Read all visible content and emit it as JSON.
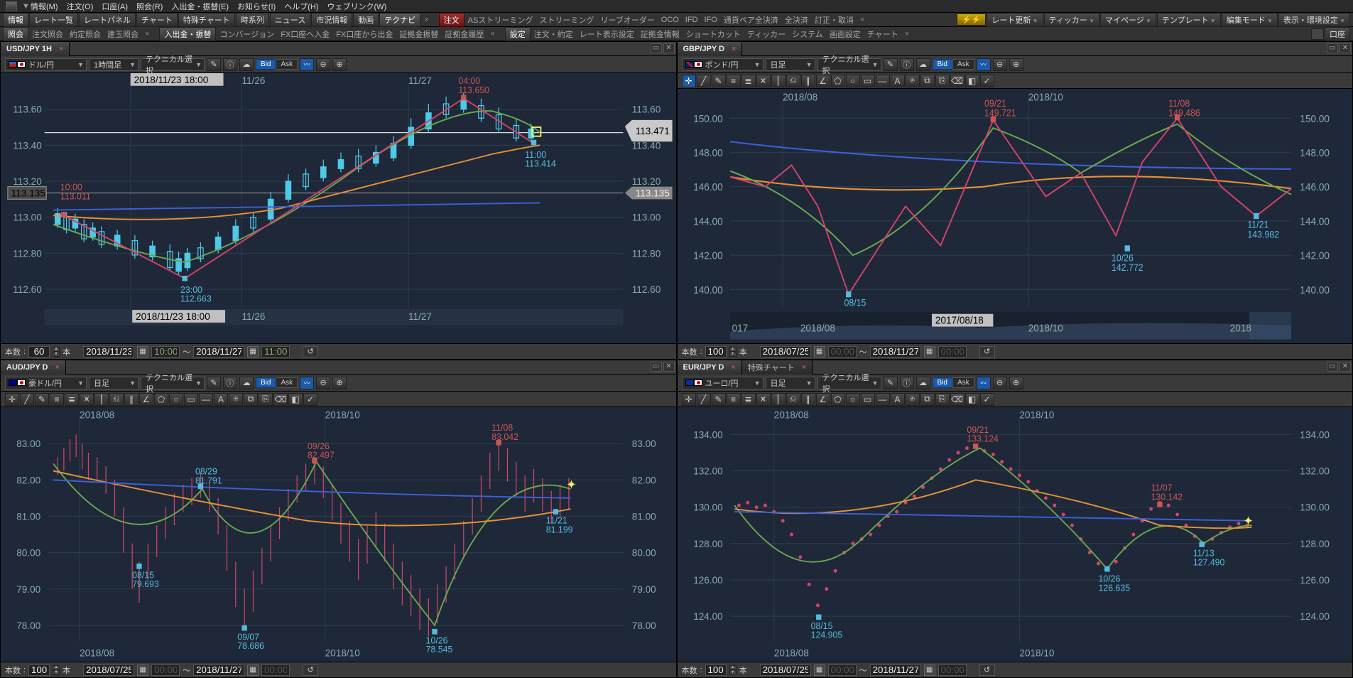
{
  "menubar": [
    "情報(M)",
    "注文(O)",
    "口座(A)",
    "照会(R)",
    "入出金・振替(E)",
    "お知らせ(I)",
    "ヘルプ(H)",
    "ウェブリンク(W)"
  ],
  "toolbar1": {
    "start": "情報",
    "items": [
      "レート一覧",
      "レートパネル",
      "チャート",
      "特殊チャート",
      "時系列",
      "ニュース",
      "市況情報",
      "動画"
    ],
    "highlighted": "テクナビ",
    "order": "注文",
    "right_items": [
      "ASストリーミング",
      "ストリーミング",
      "リーブオーダー",
      "OCO",
      "IFD",
      "IFO",
      "通貨ペア全決済",
      "全決済",
      "訂正・取消"
    ],
    "rate_btn": "レート更新",
    "r_buttons": [
      "ティッカー",
      "マイページ",
      "テンプレート",
      "編集モード",
      "表示・環境設定"
    ]
  },
  "toolbar2": {
    "start": "照会",
    "items": [
      "注文照会",
      "約定照会",
      "建玉照会"
    ],
    "start2": "入出金・振替",
    "items2": [
      "コンバージョン",
      "FX口座へ入金",
      "FX口座から出金",
      "証拠金振替",
      "証拠金履歴"
    ],
    "start3": "設定",
    "items3": [
      "注文・約定",
      "レート表示設定",
      "証拠金情報",
      "ショートカット",
      "ティッカー",
      "システム",
      "画面設定",
      "チャート"
    ],
    "acct": "口座"
  },
  "panels": [
    {
      "tab": "USD/JPY 1H",
      "pair_flags": [
        "us",
        "jp"
      ],
      "pair_label": "ドル/円",
      "timeframe": "1時間足",
      "tech": "テクニカル選択",
      "x_dates": [
        "2018/11/23 18:00",
        "11/26",
        "11/27"
      ],
      "y_ticks": [
        "113.60",
        "113.40",
        "113.20",
        "113.00",
        "112.80",
        "112.60"
      ],
      "y_ticks_r": [
        "113.60",
        "113.40",
        "113.20",
        "113.00",
        "112.80",
        "112.60"
      ],
      "price_tag_l": "113.135",
      "price_tag_r": "113.471",
      "price_tag_r2": "113.135",
      "annots": [
        {
          "t": "10:00",
          "v": "113.011",
          "c": "#c55"
        },
        {
          "t": "23:00",
          "v": "112.663",
          "c": "#5bd"
        },
        {
          "t": "04:00",
          "v": "113.650",
          "c": "#c55"
        },
        {
          "t": "11:00",
          "v": "113.414",
          "c": "#5bd"
        }
      ],
      "time_box": "2018/11/23 18:00",
      "bottom": {
        "count": "60",
        "label": "本数",
        "unit": "本",
        "from": "2018/11/23",
        "from_t": "10:00",
        "sep": "～",
        "to": "2018/11/27",
        "to_t": "11:00"
      }
    },
    {
      "tab": "GBP/JPY D",
      "pair_flags": [
        "gb",
        "jp"
      ],
      "pair_label": "ポンド/円",
      "timeframe": "日足",
      "tech": "テクニカル選択",
      "x_dates": [
        "2018/08",
        "2018/10"
      ],
      "y_ticks": [
        "150.00",
        "148.00",
        "146.00",
        "144.00",
        "142.00",
        "140.00"
      ],
      "annots": [
        {
          "t": "09/21",
          "v": "149.721",
          "c": "#c55"
        },
        {
          "t": "11/08",
          "v": "149.486",
          "c": "#c55"
        },
        {
          "t": "08/15",
          "v": "",
          "c": "#5bd"
        },
        {
          "t": "10/26",
          "v": "142.772",
          "c": "#5bd"
        },
        {
          "t": "11/21",
          "v": "143.982",
          "c": "#5bd"
        }
      ],
      "mini_x": [
        "017",
        "2018/08",
        "2018/10",
        "2018"
      ],
      "mini_box": "2017/08/18",
      "bottom": {
        "count": "100",
        "label": "本数",
        "unit": "本",
        "from": "2018/07/25",
        "from_t": "",
        "sep": "～",
        "to": "2018/11/27",
        "to_t": ""
      }
    },
    {
      "tab": "AUD/JPY D",
      "pair_flags": [
        "au",
        "jp"
      ],
      "pair_label": "豪ドル/円",
      "timeframe": "日足",
      "tech": "テクニカル選択",
      "x_dates": [
        "2018/08",
        "2018/10"
      ],
      "y_ticks": [
        "83.00",
        "82.00",
        "81.00",
        "80.00",
        "79.00",
        "78.00"
      ],
      "annots": [
        {
          "t": "08/29",
          "v": "81.791",
          "c": "#5bd"
        },
        {
          "t": "09/26",
          "v": "82.497",
          "c": "#c55"
        },
        {
          "t": "11/08",
          "v": "83.042",
          "c": "#c55"
        },
        {
          "t": "08/15",
          "v": "79.693",
          "c": "#5bd"
        },
        {
          "t": "09/07",
          "v": "78.686",
          "c": "#5bd"
        },
        {
          "t": "10/26",
          "v": "78.545",
          "c": "#5bd"
        },
        {
          "t": "11/21",
          "v": "81.199",
          "c": "#5bd"
        }
      ],
      "bottom": {
        "count": "100",
        "label": "本数",
        "unit": "本",
        "from": "2018/07/25",
        "from_t": "",
        "sep": "～",
        "to": "2018/11/27",
        "to_t": ""
      }
    },
    {
      "tab": "EUR/JPY D",
      "tab2": "特殊チャート",
      "pair_flags": [
        "eu",
        "jp"
      ],
      "pair_label": "ユーロ/円",
      "timeframe": "日足",
      "tech": "テクニカル選択",
      "x_dates": [
        "2018/08",
        "2018/10"
      ],
      "y_ticks": [
        "134.00",
        "132.00",
        "130.00",
        "128.00",
        "126.00",
        "124.00"
      ],
      "annots": [
        {
          "t": "09/21",
          "v": "133.124",
          "c": "#c55"
        },
        {
          "t": "11/07",
          "v": "130.142",
          "c": "#c55"
        },
        {
          "t": "08/15",
          "v": "124.905",
          "c": "#5bd"
        },
        {
          "t": "10/26",
          "v": "126.635",
          "c": "#5bd"
        },
        {
          "t": "11/13",
          "v": "127.490",
          "c": "#5bd"
        }
      ],
      "bottom": {
        "count": "100",
        "label": "本数",
        "unit": "本",
        "from": "2018/07/25",
        "from_t": "",
        "sep": "～",
        "to": "2018/11/27",
        "to_t": ""
      }
    }
  ],
  "bidask": {
    "bid": "Bid",
    "ask": "Ask"
  },
  "chart_data": [
    {
      "type": "line",
      "pair": "USD/JPY",
      "timeframe": "1H",
      "xlim": [
        "2018-11-23 18:00",
        "2018-11-27 11:00"
      ],
      "ylim": [
        112.5,
        113.7
      ],
      "zigzag": [
        [
          "2018-11-23 10:00",
          113.011
        ],
        [
          "2018-11-23 23:00",
          112.663
        ],
        [
          "2018-11-27 04:00",
          113.65
        ],
        [
          "2018-11-27 11:00",
          113.414
        ]
      ],
      "current": 113.471,
      "ref": 113.135
    },
    {
      "type": "line",
      "pair": "GBP/JPY",
      "timeframe": "D",
      "xlim": [
        "2018-07-25",
        "2018-11-27"
      ],
      "ylim": [
        139.0,
        151.0
      ],
      "zigzag": [
        [
          "2018-08-15",
          139.9
        ],
        [
          "2018-09-21",
          149.721
        ],
        [
          "2018-10-26",
          142.772
        ],
        [
          "2018-11-08",
          149.486
        ],
        [
          "2018-11-21",
          143.982
        ]
      ]
    },
    {
      "type": "line",
      "pair": "AUD/JPY",
      "timeframe": "D",
      "xlim": [
        "2018-07-25",
        "2018-11-27"
      ],
      "ylim": [
        78.0,
        83.5
      ],
      "zigzag": [
        [
          "2018-08-15",
          79.693
        ],
        [
          "2018-08-29",
          81.791
        ],
        [
          "2018-09-07",
          78.686
        ],
        [
          "2018-09-26",
          82.497
        ],
        [
          "2018-10-26",
          78.545
        ],
        [
          "2018-11-08",
          83.042
        ],
        [
          "2018-11-21",
          81.199
        ]
      ]
    },
    {
      "type": "scatter",
      "pair": "EUR/JPY",
      "timeframe": "D",
      "xlim": [
        "2018-07-25",
        "2018-11-27"
      ],
      "ylim": [
        124.0,
        134.0
      ],
      "zigzag": [
        [
          "2018-08-15",
          124.905
        ],
        [
          "2018-09-21",
          133.124
        ],
        [
          "2018-10-26",
          126.635
        ],
        [
          "2018-11-07",
          130.142
        ],
        [
          "2018-11-13",
          127.49
        ]
      ]
    }
  ]
}
